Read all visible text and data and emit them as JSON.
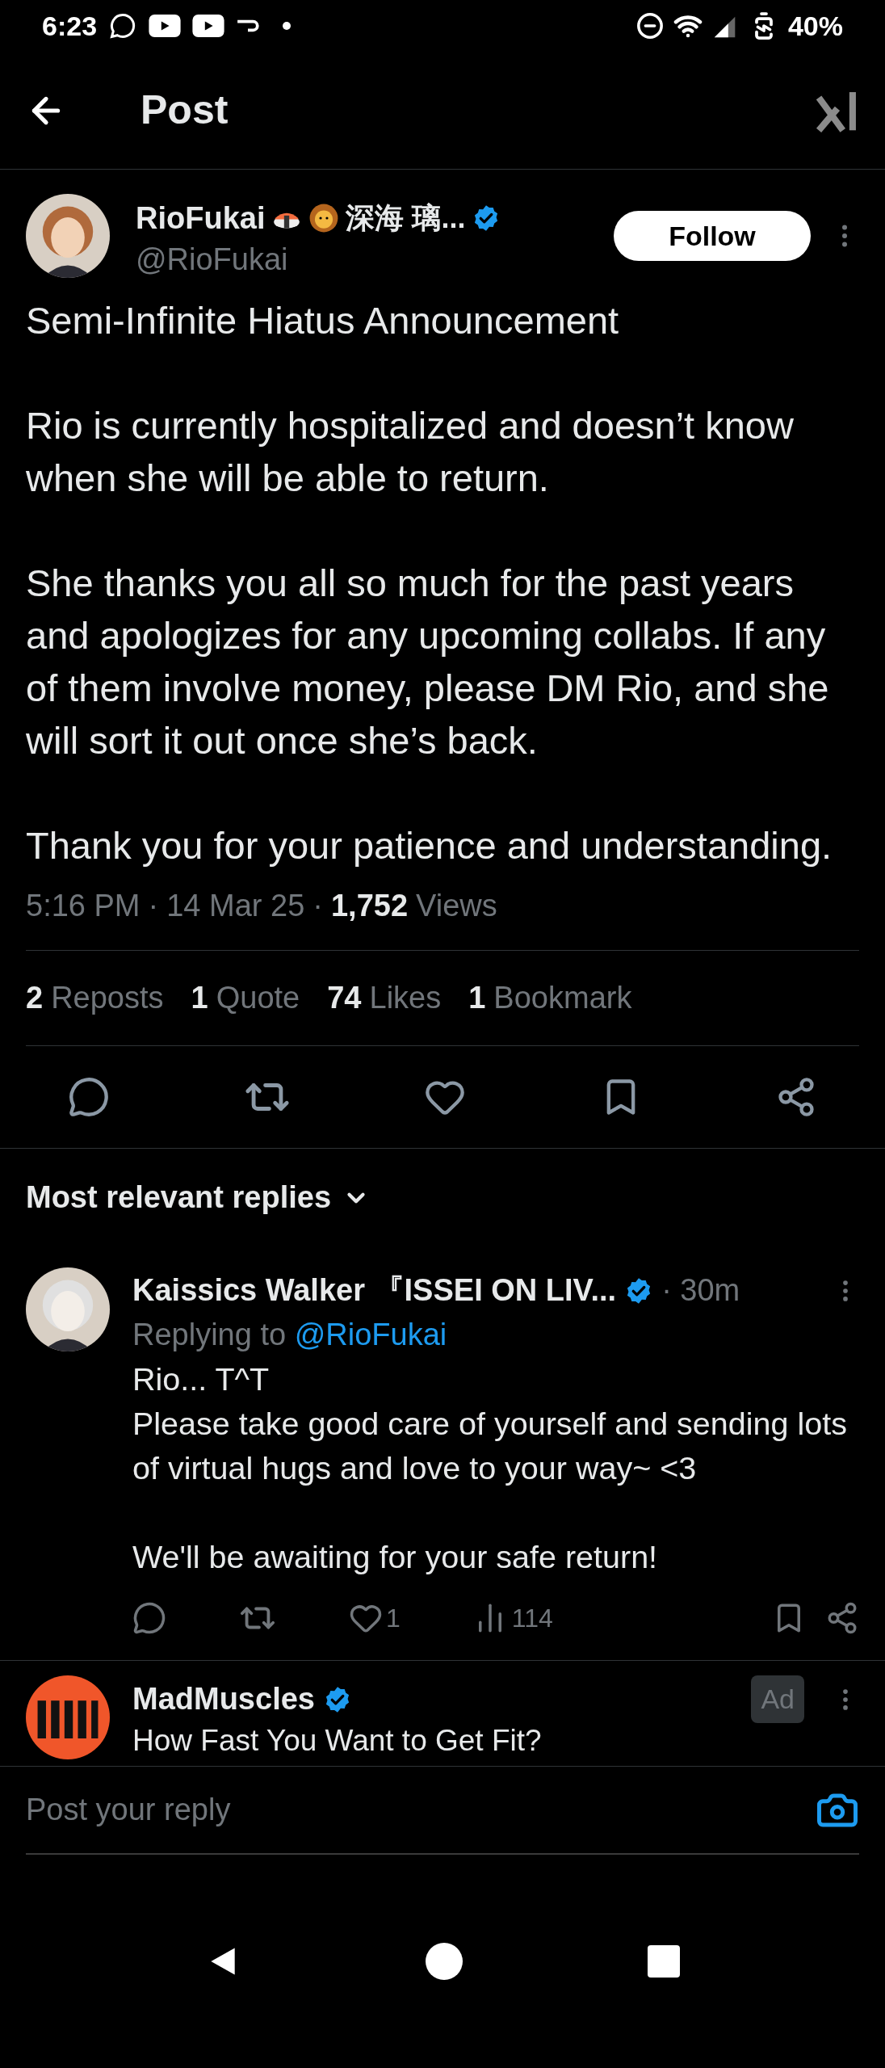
{
  "status_bar": {
    "time": "6:23",
    "battery": "40%"
  },
  "header": {
    "title": "Post"
  },
  "post": {
    "author": {
      "name": "RioFukai",
      "name_rest": "深海 璃...",
      "handle": "@RioFukai",
      "verified": true
    },
    "follow_label": "Follow",
    "paragraphs": [
      "Semi-Infinite Hiatus Announcement",
      "Rio is currently hospitalized and doesn’t know when she will be able to return.",
      "She thanks you all so much for the past years and apologizes for any upcoming collabs. If any of them involve money, please DM Rio, and she will sort it out once she’s back.",
      "Thank you for your patience and understanding."
    ],
    "time": "5:16 PM",
    "separator": "·",
    "date": "14 Mar 25",
    "views_count": "1,752",
    "views_label": "Views",
    "stats": [
      {
        "count": "2",
        "label": "Reposts"
      },
      {
        "count": "1",
        "label": "Quote"
      },
      {
        "count": "74",
        "label": "Likes"
      },
      {
        "count": "1",
        "label": "Bookmark"
      }
    ]
  },
  "replies_sort": "Most relevant replies",
  "replies": [
    {
      "name": "Kaissics Walker 『ISSEI ON LIV...",
      "verified": true,
      "time": "· 30m",
      "replying_prefix": "Replying to",
      "replying_handle": "@RioFukai",
      "paragraphs": [
        "Rio... T^T\nPlease take good care of yourself and sending lots of virtual hugs and love to your way~ <3",
        "We'll be awaiting for your safe return!"
      ],
      "likes": "1",
      "views": "114"
    }
  ],
  "ad": {
    "name": "MadMuscles",
    "verified": true,
    "badge": "Ad",
    "text": "How Fast You Want to Get Fit?"
  },
  "composer": {
    "placeholder": "Post your reply"
  }
}
